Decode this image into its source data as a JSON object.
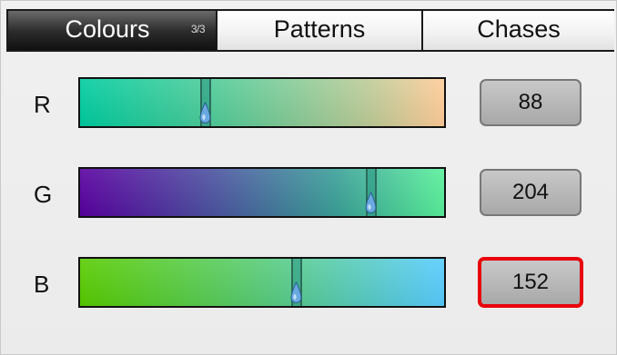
{
  "tabs": [
    {
      "label": "Colours",
      "page_indicator": "3/3",
      "active": true
    },
    {
      "label": "Patterns",
      "active": false
    },
    {
      "label": "Chases",
      "active": false
    }
  ],
  "channels": [
    {
      "label": "R",
      "value": "88",
      "level": 0.345,
      "selected": false
    },
    {
      "label": "G",
      "value": "204",
      "level": 0.8,
      "selected": false
    },
    {
      "label": "B",
      "value": "152",
      "level": 0.596,
      "selected": true
    }
  ],
  "colors": {
    "tab_active": "#101010",
    "selection_outline": "#e8000a",
    "value_box": "#b8b8b8",
    "handle": "#6aa9e0"
  },
  "icons": {
    "slider_handle": "teardrop-handle-icon"
  }
}
